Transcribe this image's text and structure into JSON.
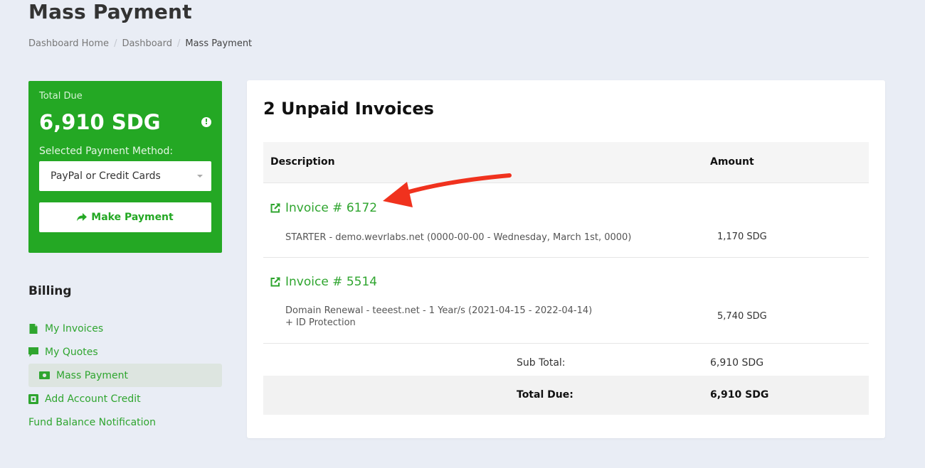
{
  "page": {
    "title": "Mass Payment",
    "breadcrumb": [
      "Dashboard Home",
      "Dashboard",
      "Mass Payment"
    ]
  },
  "due_card": {
    "label": "Total Due",
    "amount": "6,910 SDG",
    "method_label": "Selected Payment Method:",
    "method_value": "PayPal or Credit Cards",
    "pay_button": "Make Payment",
    "bg_color": "#24a824"
  },
  "billing": {
    "title": "Billing",
    "items": [
      {
        "label": "My Invoices",
        "icon": "file-icon"
      },
      {
        "label": "My Quotes",
        "icon": "comment-icon"
      },
      {
        "label": "Mass Payment",
        "icon": "money-icon",
        "active": true
      },
      {
        "label": "Add Account Credit",
        "icon": "credit-icon"
      },
      {
        "label": "Fund Balance Notification",
        "icon": ""
      }
    ]
  },
  "invoices": {
    "title": "2 Unpaid Invoices",
    "columns": [
      "Description",
      "Amount"
    ],
    "rows": [
      {
        "link": "Invoice # 6172",
        "desc_line1": "STARTER - demo.wevrlabs.net (0000-00-00 - Wednesday, March 1st, 0000)",
        "desc_line2": "",
        "amount": "1,170 SDG"
      },
      {
        "link": "Invoice # 5514",
        "desc_line1": "Domain Renewal - teeest.net - 1 Year/s (2021-04-15 - 2022-04-14)",
        "desc_line2": "+ ID Protection",
        "amount": "5,740 SDG"
      }
    ],
    "subtotal_label": "Sub Total:",
    "subtotal_value": "6,910 SDG",
    "total_label": "Total Due:",
    "total_value": "6,910 SDG"
  },
  "colors": {
    "accent": "#24a824",
    "link": "#2fa52f",
    "annotation_arrow": "#f0321e"
  }
}
